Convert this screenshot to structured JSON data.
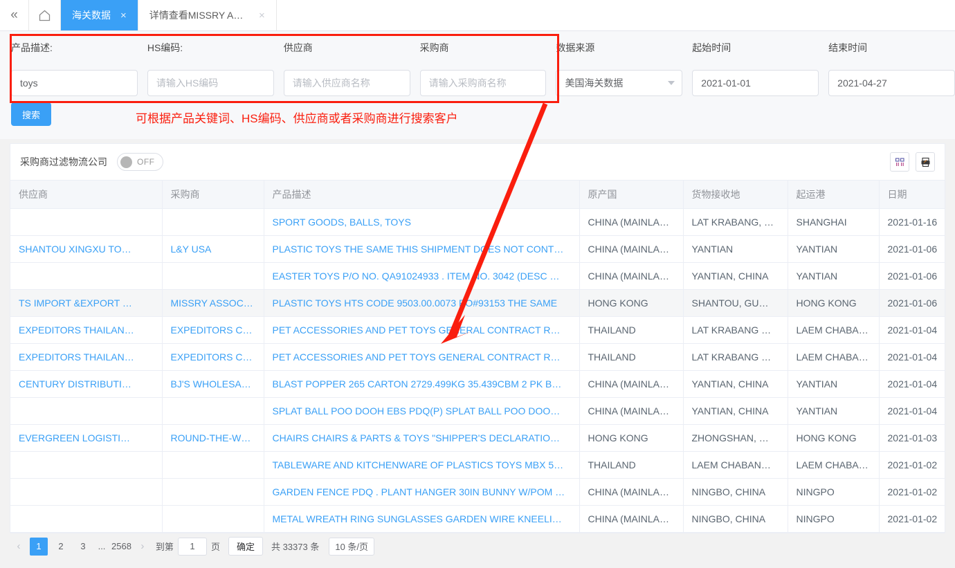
{
  "colors": {
    "accent": "#3aa0f6",
    "annotation": "#fa1e0e",
    "link": "#3aa0f6"
  },
  "tabbar": {
    "collapse_icon": "«",
    "home_icon": "home-icon",
    "tabs": [
      {
        "label": "海关数据",
        "close": "×",
        "active": true
      },
      {
        "label": "详情查看MISSRY ASS...",
        "close": "×",
        "active": false
      }
    ]
  },
  "search": {
    "fields": [
      {
        "label": "产品描述:",
        "value": "toys",
        "placeholder": "",
        "type": "text"
      },
      {
        "label": "HS编码:",
        "value": "",
        "placeholder": "请输入HS编码",
        "type": "text"
      },
      {
        "label": "供应商",
        "value": "",
        "placeholder": "请输入供应商名称",
        "type": "text"
      },
      {
        "label": "采购商",
        "value": "",
        "placeholder": "请输入采购商名称",
        "type": "text"
      },
      {
        "label": "数据来源",
        "value": "美国海关数据",
        "placeholder": "",
        "type": "select"
      },
      {
        "label": "起始时间",
        "value": "2021-01-01",
        "placeholder": "",
        "type": "date"
      },
      {
        "label": "结束时间",
        "value": "2021-04-27",
        "placeholder": "",
        "type": "date"
      }
    ],
    "button_label": "搜索",
    "annotation": "可根据产品关键词、HS编码、供应商或者采购商进行搜索客户"
  },
  "toolbar": {
    "filter_label": "采购商过滤物流公司",
    "toggle_state": "OFF",
    "icons": [
      {
        "name": "columns-icon"
      },
      {
        "name": "export-icon"
      }
    ]
  },
  "table": {
    "headers": [
      "供应商",
      "采购商",
      "产品描述",
      "原产国",
      "货物接收地",
      "起运港",
      "日期"
    ],
    "rows": [
      {
        "supplier": "",
        "buyer": "",
        "product": "SPORT GOODS, BALLS, TOYS",
        "origin": "CHINA (MAINLA…",
        "receipt": "LAT KRABANG, …",
        "port": "SHANGHAI",
        "date": "2021-01-16"
      },
      {
        "supplier": "SHANTOU XINGXU TO…",
        "buyer": "L&Y USA",
        "product": "PLASTIC TOYS THE SAME THIS SHIPMENT DOES NOT CONT…",
        "origin": "CHINA (MAINLA…",
        "receipt": "YANTIAN",
        "port": "YANTIAN",
        "date": "2021-01-06"
      },
      {
        "supplier": "",
        "buyer": "",
        "product": "EASTER TOYS P/O NO. QA91024933 . ITEM NO. 3042 (DESC …",
        "origin": "CHINA (MAINLA…",
        "receipt": "YANTIAN, CHINA",
        "port": "YANTIAN",
        "date": "2021-01-06"
      },
      {
        "supplier": "TS IMPORT &EXPORT …",
        "buyer": "MISSRY ASSOC…",
        "product": "PLASTIC TOYS HTS CODE 9503.00.0073 PO#93153 THE SAME",
        "origin": "HONG KONG",
        "receipt": "SHANTOU, GU…",
        "port": "HONG KONG",
        "date": "2021-01-06"
      },
      {
        "supplier": "EXPEDITORS THAILAN…",
        "buyer": "EXPEDITORS C…",
        "product": "PET ACCESSORIES AND PET TOYS GENERAL CONTRACT R…",
        "origin": "THAILAND",
        "receipt": "LAT KRABANG …",
        "port": "LAEM CHABANG",
        "date": "2021-01-04"
      },
      {
        "supplier": "EXPEDITORS THAILAN…",
        "buyer": "EXPEDITORS C…",
        "product": "PET ACCESSORIES AND PET TOYS GENERAL CONTRACT R…",
        "origin": "THAILAND",
        "receipt": "LAT KRABANG …",
        "port": "LAEM CHABANG",
        "date": "2021-01-04"
      },
      {
        "supplier": "CENTURY DISTRIBUTI…",
        "buyer": "BJ'S WHOLESA…",
        "product": "BLAST POPPER 265 CARTON 2729.499KG 35.439CBM 2 PK B…",
        "origin": "CHINA (MAINLA…",
        "receipt": "YANTIAN, CHINA",
        "port": "YANTIAN",
        "date": "2021-01-04"
      },
      {
        "supplier": "",
        "buyer": "",
        "product": "SPLAT BALL POO DOOH EBS PDQ(P) SPLAT BALL POO DOO…",
        "origin": "CHINA (MAINLA…",
        "receipt": "YANTIAN, CHINA",
        "port": "YANTIAN",
        "date": "2021-01-04"
      },
      {
        "supplier": "EVERGREEN LOGISTI…",
        "buyer": "ROUND-THE-W…",
        "product": "CHAIRS CHAIRS & PARTS & TOYS \"SHIPPER'S DECLARATIO…",
        "origin": "HONG KONG",
        "receipt": "ZHONGSHAN, …",
        "port": "HONG KONG",
        "date": "2021-01-03"
      },
      {
        "supplier": "",
        "buyer": "",
        "product": "TABLEWARE AND KITCHENWARE OF PLASTICS TOYS MBX 5…",
        "origin": "THAILAND",
        "receipt": "LAEM CHABAN…",
        "port": "LAEM CHABANG",
        "date": "2021-01-02"
      },
      {
        "supplier": "",
        "buyer": "",
        "product": "GARDEN FENCE PDQ . PLANT HANGER 30IN BUNNY W/POM …",
        "origin": "CHINA (MAINLA…",
        "receipt": "NINGBO, CHINA",
        "port": "NINGPO",
        "date": "2021-01-02"
      },
      {
        "supplier": "",
        "buyer": "",
        "product": "METAL WREATH RING SUNGLASSES GARDEN WIRE KNEELI…",
        "origin": "CHINA (MAINLA…",
        "receipt": "NINGBO, CHINA",
        "port": "NINGPO",
        "date": "2021-01-02"
      }
    ]
  },
  "pagination": {
    "prev_icon": "‹",
    "next_icon": "›",
    "pages": [
      "1",
      "2",
      "3"
    ],
    "dots": "...",
    "last_page": "2568",
    "current_page": "1",
    "goto_prefix": "到第",
    "goto_value": "1",
    "goto_suffix": "页",
    "confirm_label": "确定",
    "total_label": "共 33373 条",
    "page_size_label": "10 条/页"
  }
}
